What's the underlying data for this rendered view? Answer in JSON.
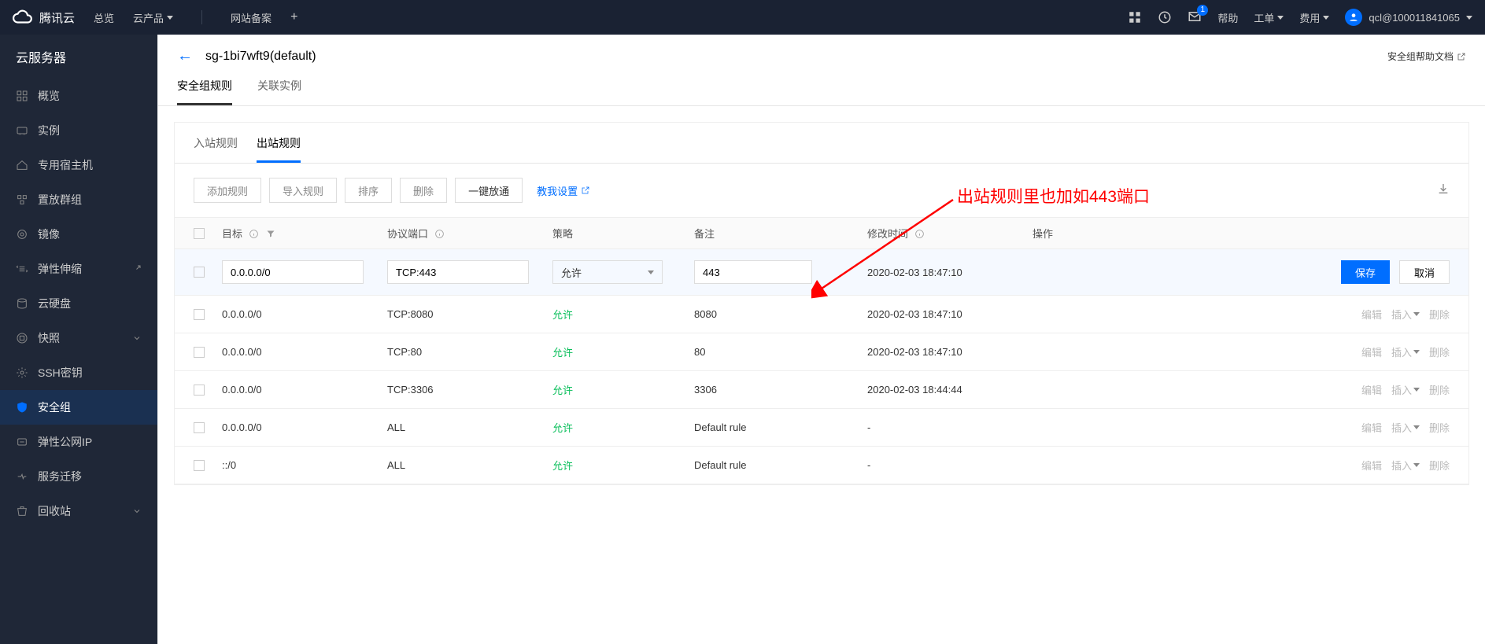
{
  "header": {
    "brand": "腾讯云",
    "nav": {
      "overview": "总览",
      "products": "云产品",
      "beian": "网站备案"
    },
    "help": "帮助",
    "tickets": "工单",
    "fees": "费用",
    "mail_badge": "1",
    "user": "qcl@100011841065"
  },
  "sidebar": {
    "title": "云服务器",
    "items": [
      {
        "label": "概览"
      },
      {
        "label": "实例"
      },
      {
        "label": "专用宿主机"
      },
      {
        "label": "置放群组"
      },
      {
        "label": "镜像"
      },
      {
        "label": "弹性伸缩",
        "ext": true
      },
      {
        "label": "云硬盘"
      },
      {
        "label": "快照",
        "chevron": true
      },
      {
        "label": "SSH密钥"
      },
      {
        "label": "安全组",
        "active": true
      },
      {
        "label": "弹性公网IP"
      },
      {
        "label": "服务迁移"
      },
      {
        "label": "回收站",
        "chevron": true
      }
    ]
  },
  "page": {
    "title": "sg-1bi7wft9(default)",
    "help_link": "安全组帮助文档",
    "tabs1": {
      "rules": "安全组规则",
      "assoc": "关联实例"
    },
    "tabs2": {
      "inbound": "入站规则",
      "outbound": "出站规则"
    },
    "toolbar": {
      "add": "添加规则",
      "import": "导入规则",
      "sort": "排序",
      "delete": "删除",
      "open_all": "一键放通",
      "tutorial": "教我设置"
    },
    "columns": {
      "target": "目标",
      "protocol": "协议端口",
      "policy": "策略",
      "remark": "备注",
      "time": "修改时间",
      "ops": "操作"
    },
    "edit_row": {
      "target": "0.0.0.0/0",
      "protocol": "TCP:443",
      "policy": "允许",
      "remark": "443",
      "time": "2020-02-03 18:47:10",
      "save": "保存",
      "cancel": "取消"
    },
    "rows": [
      {
        "target": "0.0.0.0/0",
        "protocol": "TCP:8080",
        "policy": "允许",
        "remark": "8080",
        "time": "2020-02-03 18:47:10"
      },
      {
        "target": "0.0.0.0/0",
        "protocol": "TCP:80",
        "policy": "允许",
        "remark": "80",
        "time": "2020-02-03 18:47:10"
      },
      {
        "target": "0.0.0.0/0",
        "protocol": "TCP:3306",
        "policy": "允许",
        "remark": "3306",
        "time": "2020-02-03 18:44:44"
      },
      {
        "target": "0.0.0.0/0",
        "protocol": "ALL",
        "policy": "允许",
        "remark": "Default rule",
        "time": "-"
      },
      {
        "target": "::/0",
        "protocol": "ALL",
        "policy": "允许",
        "remark": "Default rule",
        "time": "-"
      }
    ],
    "row_ops": {
      "edit": "编辑",
      "insert": "插入",
      "delete": "删除"
    }
  },
  "annotation": {
    "text": "出站规则里也加如443端口"
  }
}
